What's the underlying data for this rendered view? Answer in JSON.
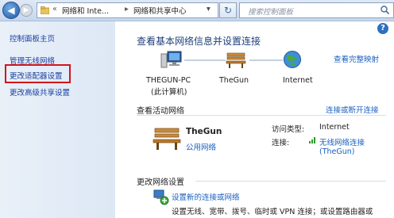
{
  "address": {
    "breadcrumb_root": "«",
    "crumb_1": "网络和 Inte...",
    "crumb_sep": "▸",
    "crumb_2": "网络和共享中心",
    "search_placeholder": "搜索控制面板"
  },
  "sidebar": {
    "items": [
      {
        "label": "控制面板主页"
      },
      {
        "label": "管理无线网络"
      },
      {
        "label": "更改适配器设置"
      },
      {
        "label": "更改高级共享设置"
      }
    ],
    "highlight_color": "#d4141c"
  },
  "main": {
    "title": "查看基本网络信息并设置连接",
    "view_full_map": "查看完整映射",
    "map": {
      "node1_name": "THEGUN-PC",
      "node1_sub": "(此计算机)",
      "node2_name": "TheGun",
      "node3_name": "Internet"
    },
    "active_title": "查看活动网络",
    "connect_disconnect": "连接或断开连接",
    "network": {
      "name": "TheGun",
      "type": "公用网络",
      "access_label": "访问类型:",
      "access_value": "Internet",
      "conn_label": "连接:",
      "conn_value_1": "无线网络连接",
      "conn_value_2": "(TheGun)"
    },
    "change_title": "更改网络设置",
    "setup_link": "设置新的连接或网络",
    "setup_desc": "设置无线、宽带、拨号、临时或 VPN 连接；或设置路由器或"
  },
  "colors": {
    "link": "#1a5fc0",
    "heading": "#1e3f7a"
  },
  "icons": [
    "back-arrow-icon",
    "forward-arrow-icon",
    "folder-icon",
    "refresh-icon",
    "search-icon",
    "help-icon",
    "computer-icon",
    "bench-icon",
    "globe-icon",
    "signal-icon",
    "network-setup-icon"
  ]
}
